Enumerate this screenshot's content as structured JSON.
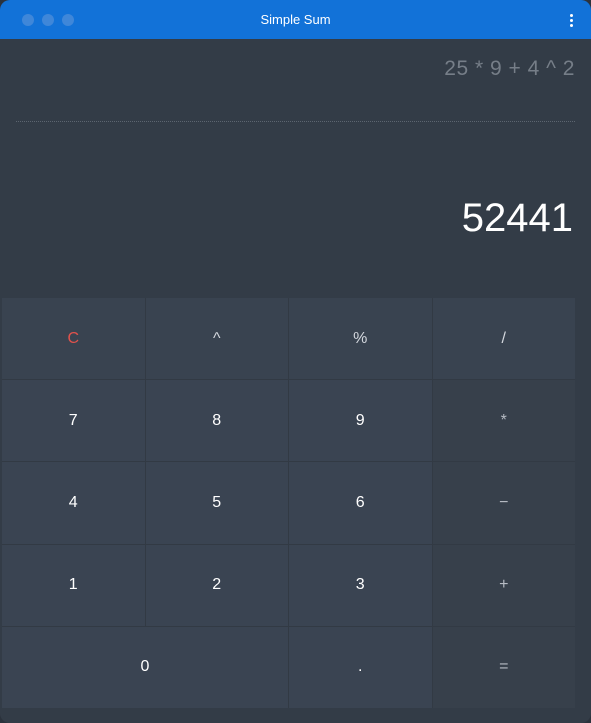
{
  "window": {
    "title": "Simple Sum",
    "titlebar_color": "#1272d8"
  },
  "display": {
    "expression": "25 * 9 + 4 ^ 2",
    "result": "52441"
  },
  "keypad": {
    "rows": [
      [
        "C",
        "^",
        "%",
        "/"
      ],
      [
        "7",
        "8",
        "9",
        "*"
      ],
      [
        "4",
        "5",
        "6",
        "−"
      ],
      [
        "1",
        "2",
        "3",
        "+"
      ],
      [
        "0",
        ".",
        "="
      ]
    ],
    "clear_color": "#e0524c"
  },
  "icons": {
    "menu": "kebab-menu-icon"
  }
}
